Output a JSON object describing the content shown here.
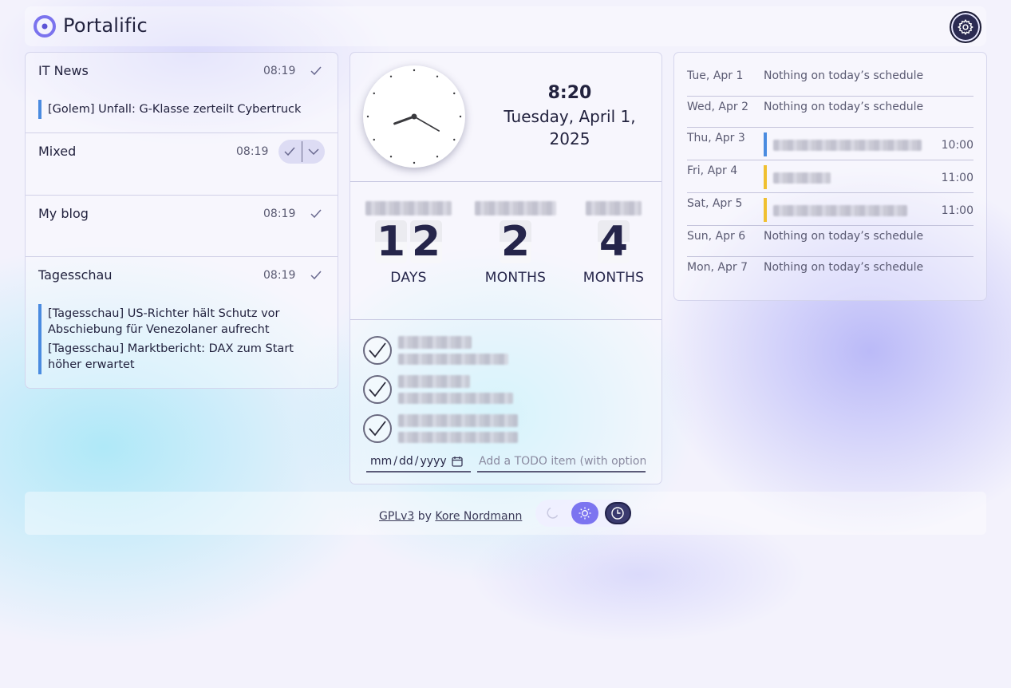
{
  "app": {
    "title": "Portalific"
  },
  "feeds": [
    {
      "title": "IT News",
      "time": "08:19",
      "items": [
        "[Golem] Unfall: G-Klasse zerteilt Cybertruck"
      ]
    },
    {
      "title": "Mixed",
      "time": "08:19",
      "items": []
    },
    {
      "title": "My blog",
      "time": "08:19",
      "items": []
    },
    {
      "title": "Tagesschau",
      "time": "08:19",
      "items": [
        "[Tagesschau] US-Richter hält Schutz vor Abschiebung für Venezolaner aufrecht",
        "[Tagesschau] Marktbericht: DAX zum Start höher erwartet"
      ]
    }
  ],
  "clock": {
    "time": "8:20",
    "date": "Tuesday, April 1, 2025",
    "hour": 8,
    "minute": 20
  },
  "countdowns": [
    {
      "digits": [
        "1",
        "2"
      ],
      "unit": "DAYS"
    },
    {
      "digits": [
        "2"
      ],
      "unit": "MONTHS"
    },
    {
      "digits": [
        "4"
      ],
      "unit": "MONTHS"
    }
  ],
  "todo": {
    "date_placeholder": [
      "mm",
      "dd",
      "yyyy"
    ],
    "input_placeholder": "Add a TODO item (with optional date)"
  },
  "calendar": [
    {
      "date": "Tue, Apr 1",
      "text": "Nothing on today’s schedule"
    },
    {
      "date": "Wed, Apr 2",
      "text": "Nothing on today’s schedule"
    },
    {
      "date": "Thu, Apr 3",
      "event_time": "10:00",
      "color": "#4a8be0"
    },
    {
      "date": "Fri, Apr 4",
      "event_time": "11:00",
      "color": "#f0c030"
    },
    {
      "date": "Sat, Apr 5",
      "event_time": "11:00",
      "color": "#f0c030"
    },
    {
      "date": "Sun, Apr 6",
      "text": "Nothing on today’s schedule"
    },
    {
      "date": "Mon, Apr 7",
      "text": "Nothing on today’s schedule"
    }
  ],
  "footer": {
    "license": "GPLv3",
    "by": "by",
    "author": "Kore Nordmann"
  },
  "icons": {
    "logo": "portalific-logo-icon",
    "settings": "gear-icon",
    "theme": [
      "moon-icon",
      "sun-icon",
      "clock-icon"
    ]
  }
}
